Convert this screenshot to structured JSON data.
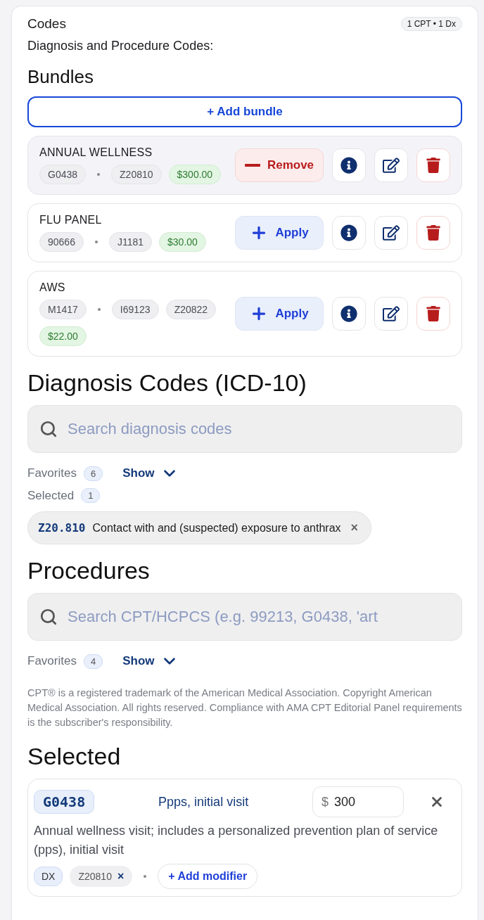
{
  "header": {
    "title": "Codes",
    "summary": "1 CPT • 1 Dx",
    "subtitle": "Diagnosis and Procedure Codes:"
  },
  "bundles": {
    "heading": "Bundles",
    "add_label": "+ Add bundle",
    "items": [
      {
        "name": "ANNUAL WELLNESS",
        "cpt": [
          "G0438"
        ],
        "dx": [
          "Z20810"
        ],
        "price": "$300.00",
        "applied": true,
        "action_label": "Remove"
      },
      {
        "name": "FLU PANEL",
        "cpt": [
          "90666"
        ],
        "dx": [
          "J1181"
        ],
        "price": "$30.00",
        "applied": false,
        "action_label": "Apply"
      },
      {
        "name": "AWS",
        "cpt": [
          "M1417"
        ],
        "dx": [
          "I69123",
          "Z20822"
        ],
        "price": "$22.00",
        "applied": false,
        "action_label": "Apply"
      }
    ]
  },
  "diagnosis": {
    "heading": "Diagnosis Codes (ICD-10)",
    "search_placeholder": "Search diagnosis codes",
    "favorites_label": "Favorites",
    "favorites_count": "6",
    "show_label": "Show",
    "selected_label": "Selected",
    "selected_count": "1",
    "selected": [
      {
        "code": "Z20.810",
        "description": "Contact with and (suspected) exposure to anthrax",
        "remove": "×"
      }
    ]
  },
  "procedures": {
    "heading": "Procedures",
    "search_placeholder": "Search CPT/HCPCS (e.g. 99213, G0438, 'art",
    "favorites_label": "Favorites",
    "favorites_count": "4",
    "show_label": "Show",
    "disclaimer": "CPT® is a registered trademark of the American Medical Association. Copyright American Medical Association. All rights reserved. Compliance with AMA CPT Editorial Panel requirements is the subscriber's responsibility."
  },
  "selected": {
    "heading": "Selected",
    "items": [
      {
        "code": "G0438",
        "title": "Ppps, initial visit",
        "currency": "$",
        "price": "300",
        "description": "Annual wellness visit; includes a personalized prevention plan of service (pps), initial visit",
        "dx_label": "DX",
        "dx": [
          {
            "code": "Z20810",
            "remove": "×"
          }
        ],
        "add_modifier": "+ Add modifier"
      }
    ]
  }
}
